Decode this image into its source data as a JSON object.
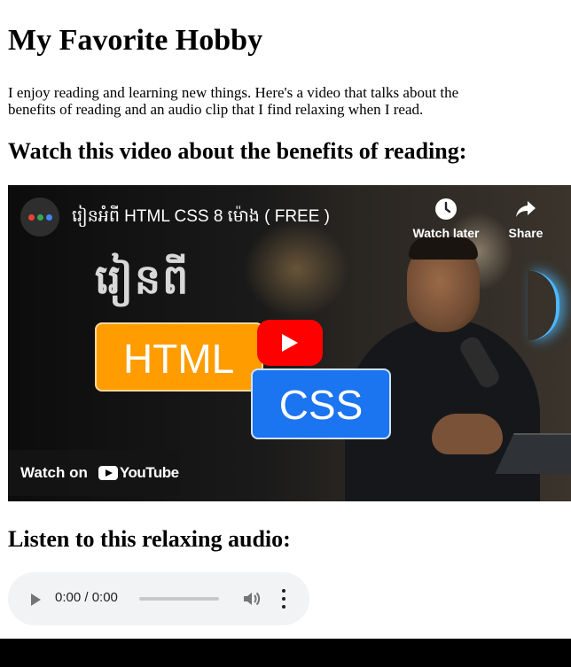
{
  "page": {
    "title": "My Favorite Hobby",
    "intro": "I enjoy reading and learning new things. Here's a video that talks about the benefits of reading and an audio clip that I find relaxing when I read.",
    "video_heading": "Watch this video about the benefits of reading:",
    "audio_heading": "Listen to this relaxing audio:"
  },
  "video": {
    "title": "រៀនអំពី HTML CSS 8 ម៉ោង ( FREE )",
    "watch_later": "Watch later",
    "share": "Share",
    "thumbnail_khmer": "រៀនពី",
    "thumbnail_html": "HTML",
    "thumbnail_css": "CSS",
    "watch_on": "Watch on",
    "youtube": "YouTube",
    "avatar_dot_colors": [
      "#ea4335",
      "#34a853",
      "#4285f4"
    ],
    "play_button_color": "#ff0000"
  },
  "audio": {
    "time": "0:00 / 0:00",
    "progress": 0
  }
}
